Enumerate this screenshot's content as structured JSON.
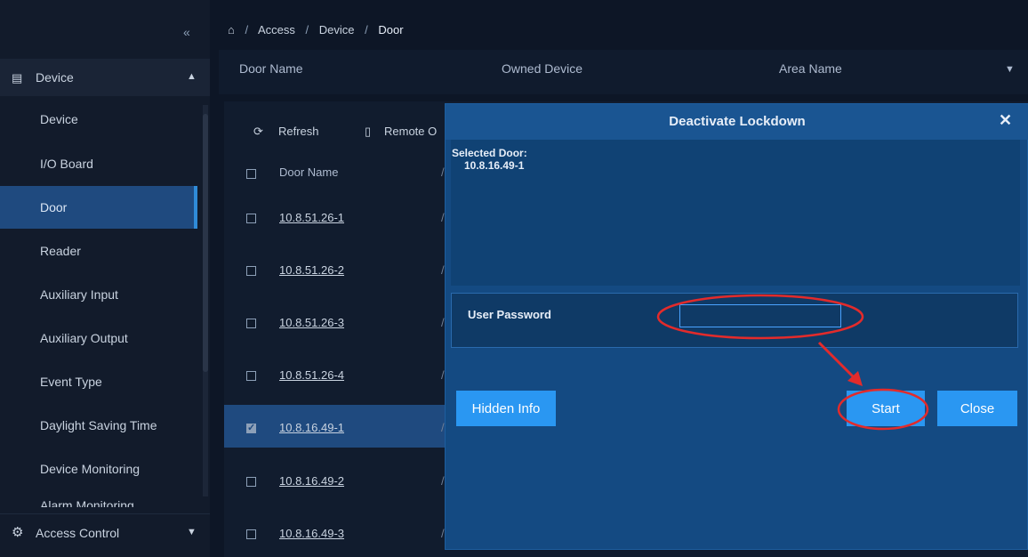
{
  "sidebar": {
    "collapse_icon": "double-chevron-left-icon",
    "group": {
      "label": "Device",
      "icon": "device-icon"
    },
    "items": [
      {
        "label": "Device",
        "active": false
      },
      {
        "label": "I/O Board",
        "active": false
      },
      {
        "label": "Door",
        "active": true
      },
      {
        "label": "Reader",
        "active": false
      },
      {
        "label": "Auxiliary Input",
        "active": false
      },
      {
        "label": "Auxiliary Output",
        "active": false
      },
      {
        "label": "Event Type",
        "active": false
      },
      {
        "label": "Daylight Saving Time",
        "active": false
      },
      {
        "label": "Device Monitoring",
        "active": false
      },
      {
        "label": "Alarm Monitoring",
        "active": false
      }
    ],
    "footer": {
      "label": "Access Control",
      "icon": "gear-icon"
    }
  },
  "breadcrumb": {
    "home_icon": "home-icon",
    "items": [
      "Access",
      "Device",
      "Door"
    ]
  },
  "filter": {
    "door_name": "Door Name",
    "owned_device": "Owned Device",
    "area_name": "Area Name"
  },
  "toolbar": {
    "refresh": "Refresh",
    "remote": "Remote O"
  },
  "table": {
    "column": "Door Name",
    "rows": [
      {
        "name": "10.8.51.26-1",
        "checked": false
      },
      {
        "name": "10.8.51.26-2",
        "checked": false
      },
      {
        "name": "10.8.51.26-3",
        "checked": false
      },
      {
        "name": "10.8.51.26-4",
        "checked": false
      },
      {
        "name": "10.8.16.49-1",
        "checked": true
      },
      {
        "name": "10.8.16.49-2",
        "checked": false
      },
      {
        "name": "10.8.16.49-3",
        "checked": false
      }
    ]
  },
  "dialog": {
    "title": "Deactivate Lockdown",
    "selected_label": "Selected Door:",
    "selected_value": "10.8.16.49-1",
    "password_label": "User Password",
    "password_value": "",
    "buttons": {
      "hidden_info": "Hidden Info",
      "start": "Start",
      "close": "Close"
    }
  },
  "colors": {
    "accent": "#2a97f2",
    "dialog_bg": "#144a82",
    "sidebar_active": "#1f4a7f",
    "annotation": "#e32b2b"
  }
}
